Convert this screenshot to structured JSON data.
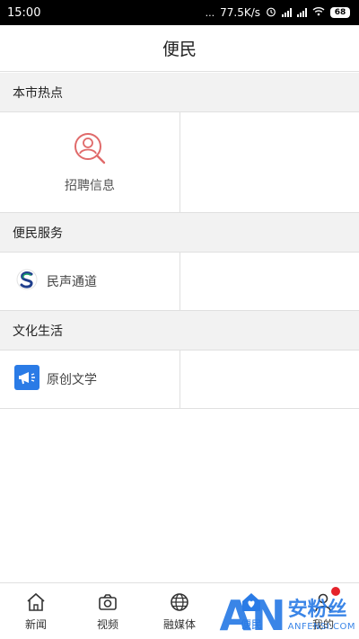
{
  "status_bar": {
    "time": "15:00",
    "dots": "...",
    "network_speed": "77.5K/s",
    "battery": "68"
  },
  "page": {
    "title": "便民"
  },
  "sections": [
    {
      "title": "本市热点",
      "items": [
        {
          "label": "招聘信息",
          "icon": "recruitment-search-icon",
          "icon_color": "#e06a6a"
        }
      ]
    },
    {
      "title": "便民服务",
      "items": [
        {
          "label": "民声通道",
          "icon": "s-logo-icon",
          "icon_color": "#1a9f6a"
        }
      ]
    },
    {
      "title": "文化生活",
      "items": [
        {
          "label": "原创文学",
          "icon": "megaphone-icon",
          "icon_color": "#2a7be6"
        }
      ]
    }
  ],
  "tabs": [
    {
      "label": "新闻",
      "icon": "home-icon"
    },
    {
      "label": "视频",
      "icon": "camera-icon"
    },
    {
      "label": "融媒体",
      "icon": "globe-icon"
    },
    {
      "label": "便民",
      "icon": "heart-house-icon",
      "active": true
    },
    {
      "label": "我的",
      "icon": "person-icon",
      "badge": true
    }
  ],
  "watermark": {
    "logo": "AN",
    "cn": "安粉丝",
    "en": "ANFENSI.COM"
  },
  "colors": {
    "accent": "#2a7be6",
    "section_bg": "#f2f2f2",
    "badge": "#e5232b"
  }
}
